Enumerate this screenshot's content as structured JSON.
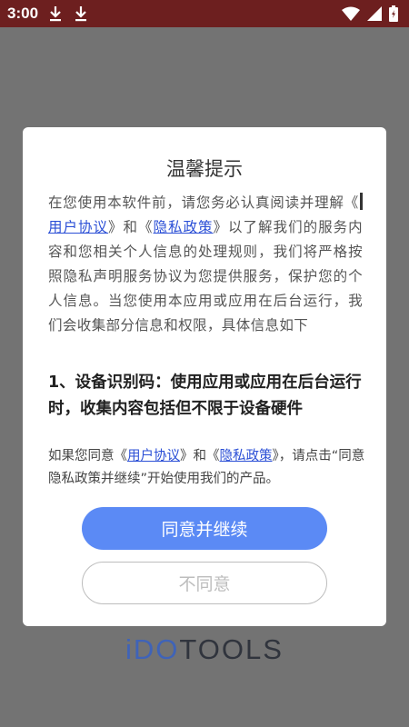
{
  "status_bar": {
    "time": "3:00",
    "icons": [
      "download-icon",
      "download-icon",
      "wifi-icon",
      "signal-icon",
      "battery-icon"
    ]
  },
  "brand": {
    "part_accent": "iDO",
    "part_rest": "TOOLS"
  },
  "dialog": {
    "title": "温馨提示",
    "intro": {
      "prefix": "在您使用本软件前，请您务必认真阅读并理解《",
      "link_user_agreement": "用户协议",
      "and1": "》和《",
      "link_privacy_policy": "隐私政策",
      "suffix": "》以了解我们的服务内容和您相关个人信息的处理规则，我们将严格按照隐私声明服务协议为您提供服务，保护您的个人信息。当您使用本应用或应用在后台运行，我们会收集部分信息和权限，具体信息如下"
    },
    "section_1": "1、设备识别码：使用应用或应用在后台运行时，收集内容包括但不限于设备硬件",
    "agree_note": {
      "prefix": "如果您同意《",
      "link_user_agreement": "用户协议",
      "and1": "》和《",
      "link_privacy_policy": "隐私政策",
      "suffix": "》，请点击“同意隐私政策并继续”开始使用我们的产品。"
    },
    "agree_button": "同意并继续",
    "disagree_button": "不同意"
  },
  "colors": {
    "status_bar": "#6d1f1f",
    "overlay": "#737373",
    "primary_button": "#5b8af5",
    "link": "#2b4fd6",
    "brand_accent": "#3f63b8"
  }
}
